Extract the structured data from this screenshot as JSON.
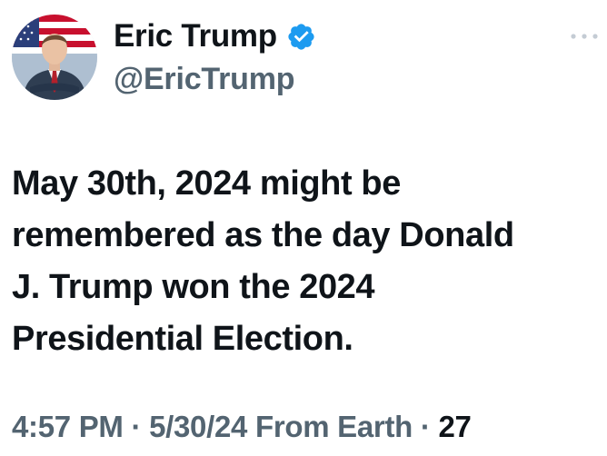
{
  "author": {
    "display_name": "Eric Trump",
    "handle": "@EricTrump",
    "verified_color": "#1d9bf0",
    "avatar_icon": "profile-photo"
  },
  "tweet": {
    "text_lines": [
      "May 30th, 2024 might be",
      "remembered as the day Donald",
      "J. Trump won the 2024",
      "Presidential Election."
    ]
  },
  "meta": {
    "time": "4:57 PM",
    "separator": "·",
    "date": "5/30/24",
    "source": "From Earth",
    "count": "27"
  },
  "colors": {
    "text": "#0f1419",
    "secondary": "#536471",
    "accent": "#1d9bf0"
  }
}
